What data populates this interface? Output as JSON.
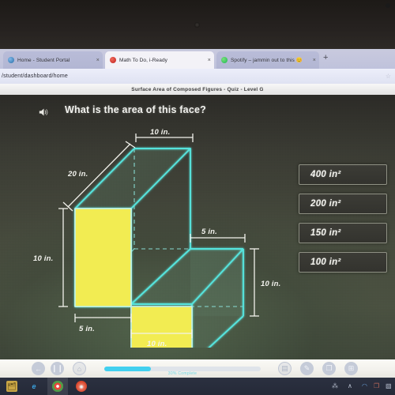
{
  "browser": {
    "tabs": [
      {
        "label": "Home - Student Portal",
        "favicon": "globe-icon",
        "close": "×",
        "active": false
      },
      {
        "label": "Math To Do, i-Ready",
        "favicon": "iready-icon",
        "close": "×",
        "active": true
      },
      {
        "label": "Spotify – jammin out to this 😊",
        "favicon": "spotify-icon",
        "close": "×",
        "active": false
      }
    ],
    "new_tab_label": "+",
    "url": "/student/dashboard/home",
    "bookmark_icon": "☆"
  },
  "app": {
    "header_title": "Surface Area of Composed Figures - Quiz - Level G",
    "question": "What is the area of this face?",
    "speaker_icon": "audio-speaker-icon"
  },
  "choices": [
    {
      "label": "400 in²"
    },
    {
      "label": "200 in²"
    },
    {
      "label": "150 in²"
    },
    {
      "label": "100 in²"
    }
  ],
  "figure": {
    "type": "composed-rectangular-prism",
    "highlighted_face_color": "#f2ec52",
    "edge_color": "#5fe8e0",
    "labels": {
      "top_width": "10 in.",
      "depth_diagonal": "20 in.",
      "step_width": "5 in.",
      "right_height": "10 in.",
      "left_height": "10 in.",
      "notch_width": "5 in.",
      "bottom_width": "10 in."
    }
  },
  "toolbar": {
    "back_label": "←",
    "pause_label": "❙❙",
    "home_label": "⌂",
    "progress_percent": 30,
    "progress_label": "30% Complete",
    "tools": [
      {
        "name": "glossary-icon",
        "glyph": "▤"
      },
      {
        "name": "pencil-icon",
        "glyph": "✎"
      },
      {
        "name": "notepad-icon",
        "glyph": "❐"
      },
      {
        "name": "calculator-icon",
        "glyph": "⊞"
      }
    ]
  },
  "taskbar": {
    "apps": [
      {
        "name": "store-icon",
        "glyph": "🗂"
      },
      {
        "name": "edge-browser-icon",
        "glyph": "e"
      },
      {
        "name": "chrome-browser-icon",
        "glyph": "●"
      },
      {
        "name": "firefox-browser-icon",
        "glyph": "●"
      }
    ],
    "tray": [
      {
        "name": "network-share-icon",
        "glyph": "⁂"
      },
      {
        "name": "show-hidden-icons-chevron",
        "glyph": "∧"
      },
      {
        "name": "volume-icon",
        "glyph": "◠"
      },
      {
        "name": "screenshot-icon",
        "glyph": "❐"
      },
      {
        "name": "action-center-icon",
        "glyph": "▧"
      }
    ]
  },
  "colors": {
    "accent": "#42d0ef",
    "figure_edge": "#5fe8e0",
    "figure_face": "#f2ec52"
  }
}
